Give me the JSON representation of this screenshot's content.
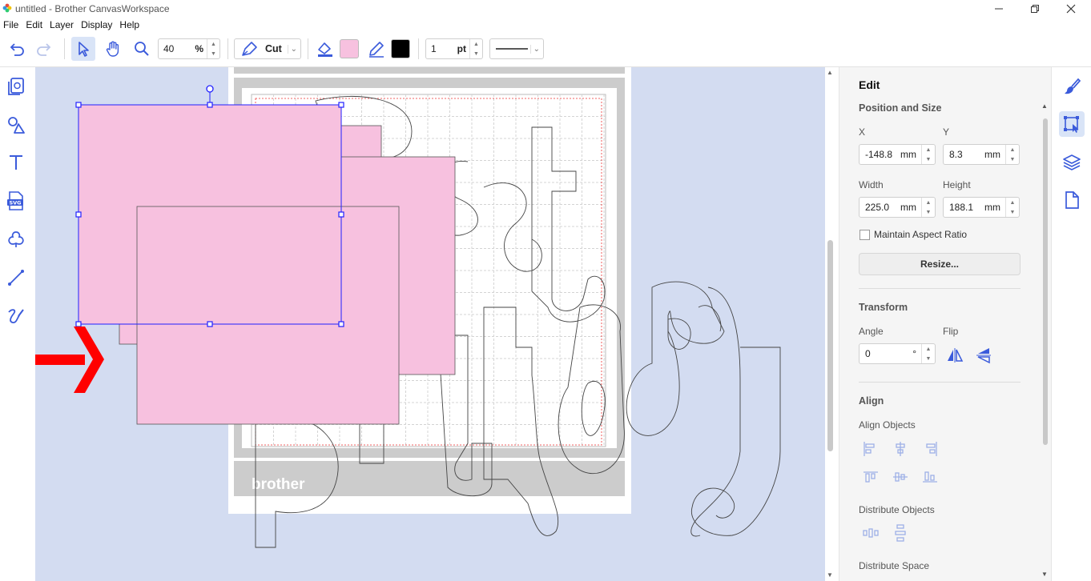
{
  "app": {
    "title": "untitled - Brother CanvasWorkspace"
  },
  "window_controls": [
    "minimize-icon",
    "restore-icon",
    "close-icon"
  ],
  "menu": [
    "File",
    "Edit",
    "Layer",
    "Display",
    "Help"
  ],
  "toolbar": {
    "zoom_value": "40",
    "zoom_unit": "%",
    "mode_label": "Cut",
    "fill_color": "#f7c1df",
    "line_color": "#000000",
    "line_width_value": "1",
    "line_width_unit": "pt",
    "accent_color": "#3b5bdb"
  },
  "left_tools": [
    "object-library-icon",
    "shapes-icon",
    "text-icon",
    "svg-import-icon",
    "trace-icon",
    "line-icon",
    "freehand-icon"
  ],
  "canvas": {
    "mat_brand": "brother",
    "background_color": "#d3dcf1",
    "selection_color": "#2020ff",
    "arrow_color": "#ff0000"
  },
  "panel": {
    "title": "Edit",
    "position_size": {
      "heading": "Position and Size",
      "x_label": "X",
      "x_value": "-148.8",
      "y_label": "Y",
      "y_value": "8.3",
      "width_label": "Width",
      "width_value": "225.0",
      "height_label": "Height",
      "height_value": "188.1",
      "unit": "mm",
      "maintain_aspect_label": "Maintain Aspect Ratio",
      "maintain_aspect_checked": false,
      "resize_label": "Resize..."
    },
    "transform": {
      "heading": "Transform",
      "angle_label": "Angle",
      "angle_value": "0",
      "angle_unit": "°",
      "flip_label": "Flip"
    },
    "align": {
      "heading": "Align",
      "align_objects_label": "Align Objects",
      "distribute_objects_label": "Distribute Objects",
      "distribute_space_label": "Distribute Space"
    }
  },
  "right_tabs": [
    "edit-brush-icon",
    "transform-icon",
    "layers-icon",
    "page-icon"
  ]
}
